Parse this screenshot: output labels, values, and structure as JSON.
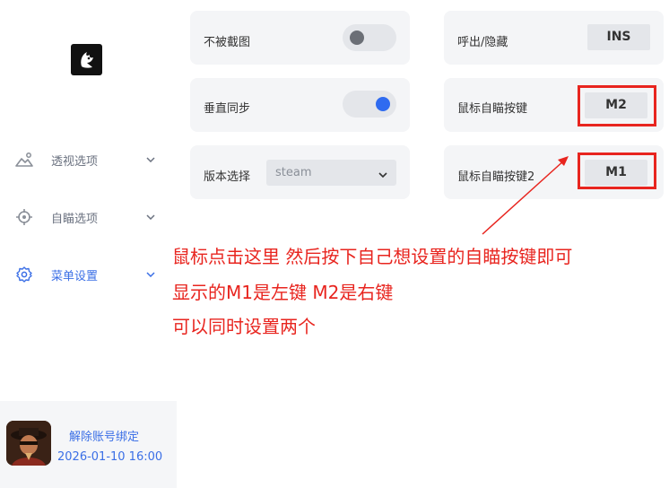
{
  "sidebar": {
    "logo_icon": "wolf-logo-icon",
    "items": [
      {
        "label": "透视选项",
        "icon": "mountain-scan-icon"
      },
      {
        "label": "自瞄选项",
        "icon": "crosshair-icon"
      },
      {
        "label": "菜单设置",
        "icon": "gear-icon",
        "active": true
      }
    ],
    "account": {
      "unbind_label": "解除账号绑定",
      "expire": "2026-01-10 16:00"
    }
  },
  "settings": {
    "no_screenshot": {
      "label": "不被截图",
      "toggle": "off"
    },
    "vsync": {
      "label": "垂直同步",
      "toggle": "on"
    },
    "version": {
      "label": "版本选择",
      "value": "steam"
    },
    "show_hide": {
      "label": "呼出/隐藏",
      "key": "INS"
    },
    "aim_key": {
      "label": "鼠标自瞄按键",
      "key": "M2"
    },
    "aim_key2": {
      "label": "鼠标自瞄按键2",
      "key": "M1"
    }
  },
  "annotation": {
    "line1": "鼠标点击这里 然后按下自己想设置的自瞄按键即可",
    "line2": "显示的M1是左键 M2是右键",
    "line3": "可以同时设置两个"
  },
  "colors": {
    "accent": "#3b6fe6",
    "toggle_on": "#2f6bf0",
    "annotation_red": "#e8251f",
    "card_bg": "#f4f5f7"
  }
}
